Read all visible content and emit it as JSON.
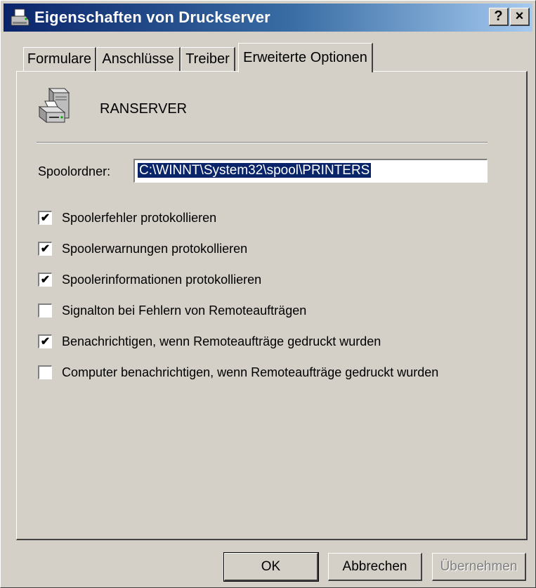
{
  "window": {
    "title": "Eigenschaften von Druckserver",
    "help_button": "?",
    "close_button": "×",
    "title_icon": "printer-icon"
  },
  "tabs": [
    {
      "label": "Formulare",
      "active": false
    },
    {
      "label": "Anschlüsse",
      "active": false
    },
    {
      "label": "Treiber",
      "active": false
    },
    {
      "label": "Erweiterte Optionen",
      "active": true
    }
  ],
  "server": {
    "name": "RANSERVER",
    "icon": "print-server-icon"
  },
  "spool": {
    "label": "Spoolordner:",
    "value": "C:\\WINNT\\System32\\spool\\PRINTERS"
  },
  "options": [
    {
      "label": "Spoolerfehler protokollieren",
      "checked": true
    },
    {
      "label": "Spoolerwarnungen protokollieren",
      "checked": true
    },
    {
      "label": "Spoolerinformationen protokollieren",
      "checked": true
    },
    {
      "label": "Signalton bei Fehlern von Remoteaufträgen",
      "checked": false
    },
    {
      "label": "Benachrichtigen, wenn Remoteaufträge gedruckt wurden",
      "checked": true
    },
    {
      "label": "Computer benachrichtigen, wenn Remoteaufträge gedruckt wurden",
      "checked": false
    }
  ],
  "buttons": {
    "ok": "OK",
    "cancel": "Abbrechen",
    "apply": "Übernehmen"
  }
}
